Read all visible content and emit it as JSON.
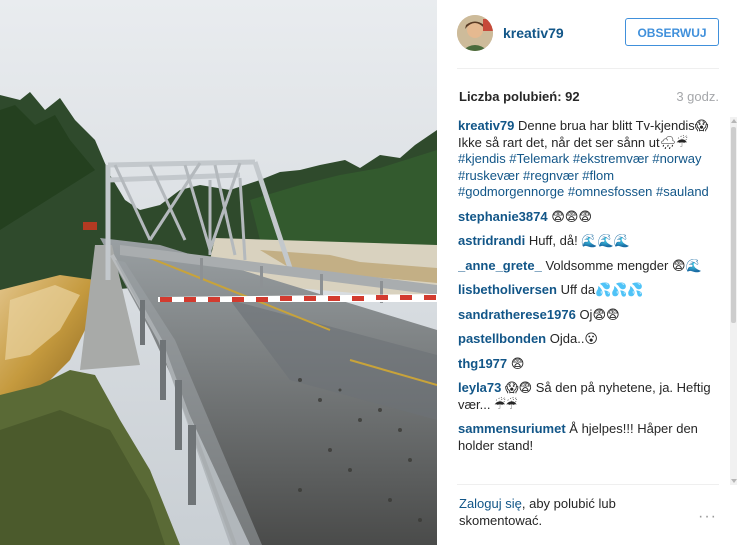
{
  "post": {
    "username": "kreativ79",
    "follow_label": "OBSERWUJ",
    "likes_label": "Liczba polubień: 92",
    "time_ago": "3 godz.",
    "caption": {
      "user": "kreativ79",
      "text1": "Denne brua har blitt Tv-kjendis😱",
      "text2": "Ikke så rart det, når det ser sånn ut🌧☔",
      "hashtags": "#kjendis #Telemark #ekstremvær #norway #ruskevær #regnvær #flom #godmorgennorge #omnesfossen #sauland"
    },
    "comments": [
      {
        "user": "stephanie3874",
        "text": "😨😨😨"
      },
      {
        "user": "astridrandi",
        "text": "Huff, då! 🌊🌊🌊"
      },
      {
        "user": "_anne_grete_",
        "text": "Voldsomme mengder 😨🌊"
      },
      {
        "user": "lisbetholiversen",
        "text": "Uff da💦💦💦"
      },
      {
        "user": "sandratherese1976",
        "text": "Oj😨😨"
      },
      {
        "user": "pastellbonden",
        "text": "Ojda..😮"
      },
      {
        "user": "thg1977",
        "text": "😨"
      },
      {
        "user": "leyla73",
        "text": "😱😨 Så den på nyhetene, ja. Heftig vær... ☔☔"
      },
      {
        "user": "sammensuriumet",
        "text": "Å hjelpes!!! Håper den holder stand!"
      }
    ],
    "footer": {
      "login_link": "Zaloguj się",
      "login_rest": ", aby polubić lub skomentować.",
      "more_label": "···"
    }
  }
}
